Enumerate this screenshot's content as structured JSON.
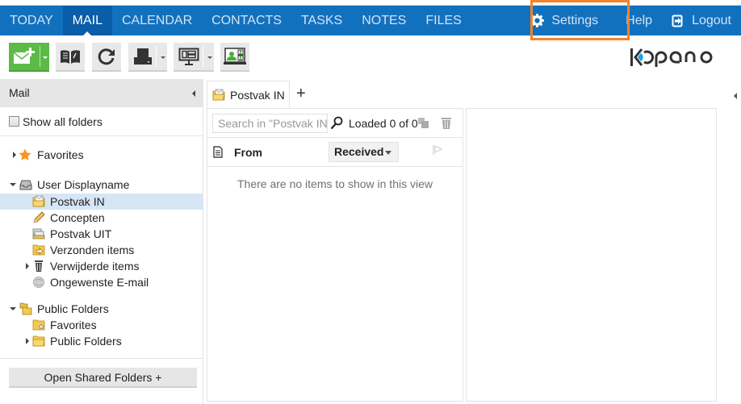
{
  "nav": {
    "items": [
      {
        "label": "TODAY",
        "active": false
      },
      {
        "label": "MAIL",
        "active": true
      },
      {
        "label": "CALENDAR",
        "active": false
      },
      {
        "label": "CONTACTS",
        "active": false
      },
      {
        "label": "TASKS",
        "active": false
      },
      {
        "label": "NOTES",
        "active": false
      },
      {
        "label": "FILES",
        "active": false
      }
    ],
    "settings_label": "Settings",
    "help_label": "Help",
    "logout_label": "Logout",
    "highlight_color": "#f5822a",
    "bar_color": "#1271bf"
  },
  "toolbar": {
    "buttons": [
      {
        "name": "new-mail",
        "icon": "envelope-plus-icon",
        "has_dropdown": true
      },
      {
        "name": "address-book",
        "icon": "book-icon",
        "has_dropdown": false
      },
      {
        "name": "refresh",
        "icon": "refresh-icon",
        "has_dropdown": false
      },
      {
        "name": "print",
        "icon": "printer-icon",
        "has_dropdown": true
      },
      {
        "name": "layout",
        "icon": "monitor-layout-icon",
        "has_dropdown": true
      },
      {
        "name": "meeting",
        "icon": "video-meeting-icon",
        "has_dropdown": false
      }
    ],
    "logo_text": "kopano",
    "accent_green": "#5cba47"
  },
  "sidebar": {
    "title": "Mail",
    "show_all_folders_label": "Show all folders",
    "show_all_folders_checked": false,
    "tree": [
      {
        "label": "Favorites",
        "icon": "star-icon",
        "toggle": "collapsed",
        "level": 0
      },
      {
        "label": "User Displayname",
        "icon": "inbox-tray-icon",
        "toggle": "expanded",
        "level": 0
      },
      {
        "label": "Postvak IN",
        "icon": "inbox-folder-icon",
        "toggle": "none",
        "level": 1,
        "selected": true
      },
      {
        "label": "Concepten",
        "icon": "pencil-icon",
        "toggle": "none",
        "level": 1
      },
      {
        "label": "Postvak UIT",
        "icon": "outbox-icon",
        "toggle": "none",
        "level": 1
      },
      {
        "label": "Verzonden items",
        "icon": "sent-folder-icon",
        "toggle": "none",
        "level": 1
      },
      {
        "label": "Verwijderde items",
        "icon": "trash-icon",
        "toggle": "collapsed",
        "level": 1
      },
      {
        "label": "Ongewenste E-mail",
        "icon": "junk-icon",
        "toggle": "none",
        "level": 1
      },
      {
        "label": "Public Folders",
        "icon": "public-folders-icon",
        "toggle": "expanded",
        "level": 0
      },
      {
        "label": "Favorites",
        "icon": "favorites-folder-icon",
        "toggle": "none",
        "level": 1
      },
      {
        "label": "Public Folders",
        "icon": "folder-icon",
        "toggle": "collapsed",
        "level": 1
      }
    ],
    "open_shared_label": "Open Shared Folders +",
    "selected_color": "#d6e6f5"
  },
  "main": {
    "tabs": [
      {
        "label": "Postvak IN",
        "icon": "inbox-folder-icon"
      }
    ],
    "add_tab_label": "+",
    "search_placeholder": "Search in \"Postvak IN",
    "loaded_text": "Loaded 0 of 0",
    "columns": {
      "from": "From",
      "received": "Received"
    },
    "empty_message": "There are no items to show in this view"
  }
}
